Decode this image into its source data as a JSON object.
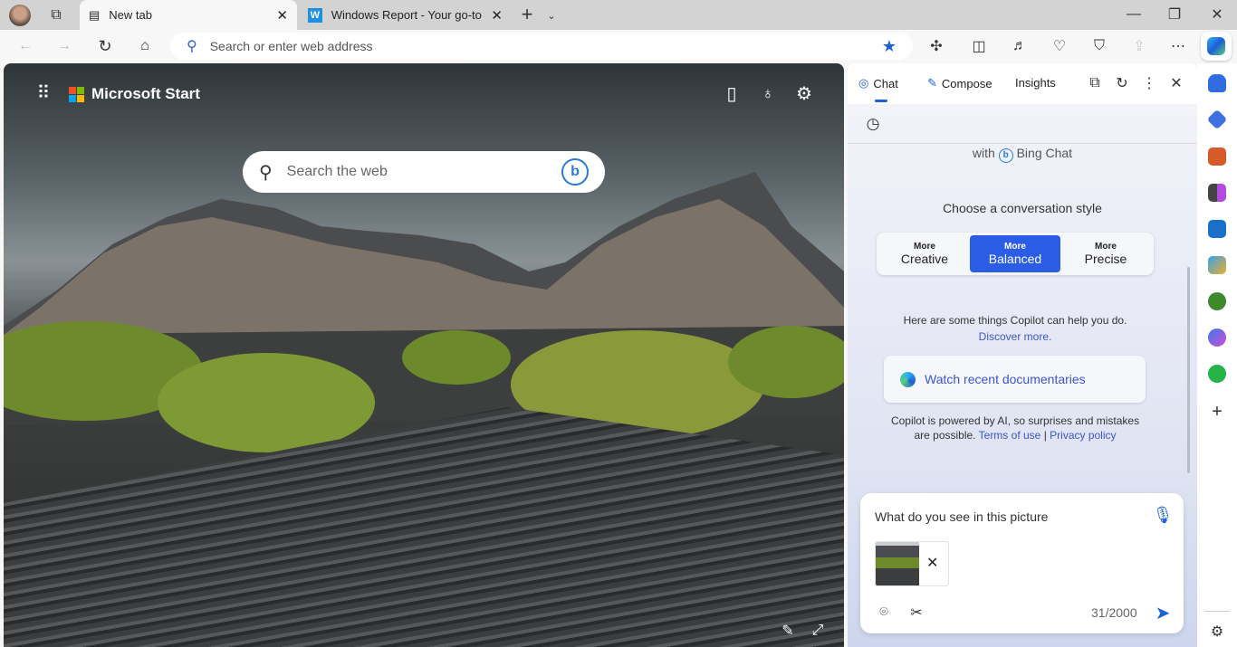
{
  "tabs": [
    {
      "label": "New tab",
      "active": true,
      "icon": "newtab-icon"
    },
    {
      "label": "Windows Report - Your go-to sou",
      "active": false,
      "icon": "windows-report-favicon"
    }
  ],
  "address": {
    "placeholder": "Search or enter web address"
  },
  "newtab": {
    "brand": "Microsoft Start",
    "search_placeholder": "Search the web"
  },
  "copilot": {
    "tabs": [
      {
        "label": "Chat"
      },
      {
        "label": "Compose"
      },
      {
        "label": "Insights"
      }
    ],
    "with_label": "with",
    "bing_chat": "Bing Chat",
    "choose_style": "Choose a conversation style",
    "styles": [
      {
        "top": "More",
        "label": "Creative"
      },
      {
        "top": "More",
        "label": "Balanced",
        "selected": true
      },
      {
        "top": "More",
        "label": "Precise"
      }
    ],
    "help_text": "Here are some things Copilot can help you do.",
    "discover": "Discover more.",
    "suggestion": "Watch recent documentaries",
    "disclaimer": "Copilot is powered by AI, so surprises and mistakes are possible.",
    "terms": "Terms of use",
    "separator": "|",
    "privacy": "Privacy policy",
    "input_value": "What do you see in this picture",
    "char_count": "31/2000"
  },
  "colors": {
    "accent": "#2a5ce6",
    "link": "#3b55c9"
  }
}
